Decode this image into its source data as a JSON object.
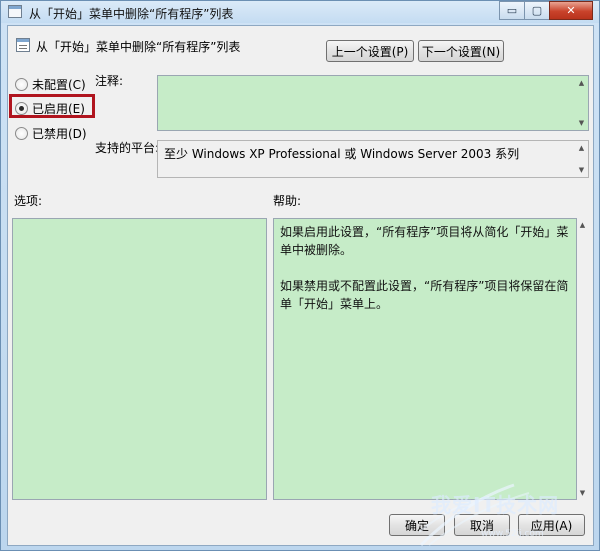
{
  "window": {
    "title": "从「开始」菜单中删除“所有程序”列表",
    "minimize_glyph": "▭",
    "maximize_glyph": "▢",
    "close_glyph": "✕"
  },
  "header": {
    "title": "从「开始」菜单中删除“所有程序”列表",
    "prev_label": "上一个设置(P)",
    "next_label": "下一个设置(N)"
  },
  "options": {
    "not_configured": "未配置(C)",
    "enabled": "已启用(E)",
    "disabled": "已禁用(D)",
    "selected": "enabled"
  },
  "labels": {
    "comment": "注释:",
    "supported_on": "支持的平台:",
    "options": "选项:",
    "help": "帮助:"
  },
  "supported_on_text": "至少 Windows XP Professional 或 Windows Server 2003 系列",
  "comment_text": "",
  "help_text": {
    "p1": "如果启用此设置，“所有程序”项目将从简化「开始」菜单中被删除。",
    "p2": "如果禁用或不配置此设置，“所有程序”项目将保留在简单「开始」菜单上。"
  },
  "footer": {
    "ok_label": "确定",
    "cancel_label": "取消",
    "apply_label": "应用(A)"
  },
  "watermark": {
    "text": "我爱IT技术网",
    "url": "www.52ij.com"
  },
  "colors": {
    "text_area_bg": "#c6ecc8",
    "highlight_border": "#b0141e",
    "close_button": "#c9432b"
  }
}
